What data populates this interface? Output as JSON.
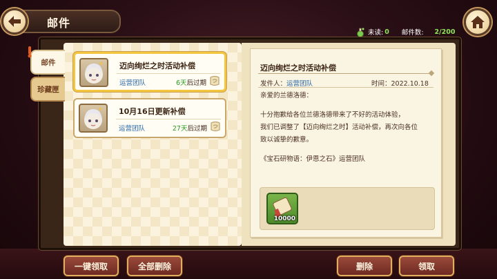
{
  "header": {
    "title": "邮件"
  },
  "stats": {
    "unread_label": "未读:",
    "unread_value": "0",
    "count_label": "邮件数:",
    "count_value": "2/200"
  },
  "tabs": [
    {
      "label": "邮件",
      "selected": true
    },
    {
      "label": "珍藏匣",
      "selected": false
    }
  ],
  "mails": [
    {
      "title": "迈向绚烂之时活动补偿",
      "sender": "运营团队",
      "days": "6天",
      "expire_suffix": "后过期",
      "selected": true
    },
    {
      "title": "10月16日更新补偿",
      "sender": "运营团队",
      "days": "27天",
      "expire_suffix": "后过期",
      "selected": false
    }
  ],
  "letter": {
    "title": "迈向绚烂之时活动补偿",
    "sender_label": "发件人：",
    "sender": "运营团队",
    "time": "时间：2022.10.18",
    "greeting": "亲爱的兰德洛德：",
    "body_lines": [
      "十分抱歉给各位兰德洛德带来了不好的活动体验，",
      "我们已调整了【迈向绚烂之时】活动补偿，再次向各位",
      "致以诚挚的歉意。"
    ],
    "signature": "《宝石研物语：伊恩之石》运营团队"
  },
  "reward": {
    "count": "10000"
  },
  "buttons": {
    "claim_all": "一键领取",
    "delete_all": "全部删除",
    "delete": "删除",
    "claim": "领取"
  },
  "colors": {
    "accent_gold": "#f4c53e",
    "sender_blue": "#2e6aa8",
    "days_green": "#2a9a22",
    "count_green": "#8fe35a"
  }
}
